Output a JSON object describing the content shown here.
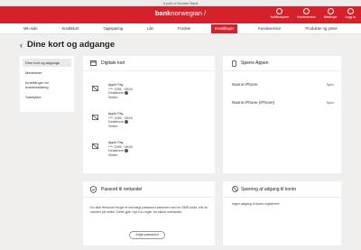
{
  "topstrip": "A part of Norske Bank",
  "brand": {
    "name_bold": "bank",
    "name_rest": "norwegian",
    "suffix": "/"
  },
  "header_icons": [
    {
      "label": "Notifikasjoner",
      "icon": "bell-icon"
    },
    {
      "label": "Kundeservice",
      "icon": "headset-icon"
    },
    {
      "label": "Meldinger",
      "icon": "mail-icon"
    },
    {
      "label": "Logg ut",
      "icon": "logout-icon"
    }
  ],
  "nav": [
    {
      "label": "Min side"
    },
    {
      "label": "Kredittkort"
    },
    {
      "label": "Oppsparing"
    },
    {
      "label": "Lån"
    },
    {
      "label": "Fordele"
    },
    {
      "label": "Innstillinger"
    },
    {
      "label": "Kundeservice"
    },
    {
      "label": "Produkter og priser"
    }
  ],
  "page": {
    "title": "Dine kort og adgange",
    "back": "‹"
  },
  "sidebar": [
    {
      "label": "Dine kort og adgange"
    },
    {
      "label": "Medeleser"
    },
    {
      "label": "Innstillinger for markedsføring"
    },
    {
      "label": "Samtykke"
    }
  ],
  "digital_cards": {
    "title": "Digitale kort",
    "items": [
      {
        "name": "Apple Pay",
        "number": "**** 2055 · 05/25",
        "status": "Deaktivere",
        "action": "Sletter"
      },
      {
        "name": "Apple Pay",
        "number": "**** 2055 · 05/25",
        "status": "Deaktivere",
        "action": "Sletter"
      },
      {
        "name": "Apple Pay",
        "number": "**** 2055 · 05/25",
        "status": "Deaktivere",
        "action": "Sletter"
      }
    ]
  },
  "block_app": {
    "title": "Sperre Appen",
    "devices": [
      {
        "name": "Navns iPhone",
        "action": "Sperr"
      },
      {
        "name": "Navns iPhone (iPhone)",
        "action": "Sperr"
      }
    ]
  },
  "password": {
    "title": "Passord til nettandel",
    "text": "Du skal fremover bruge et selvvalgt password sammen med en SMS-kode, når du handler på nettet. Dette gjør, nye EU-regler for sikker nethandel.",
    "button": "Angiv password"
  },
  "account_access": {
    "title": "Sperring af adgang til konto",
    "text": "Ingen adgang til konto registreret"
  }
}
